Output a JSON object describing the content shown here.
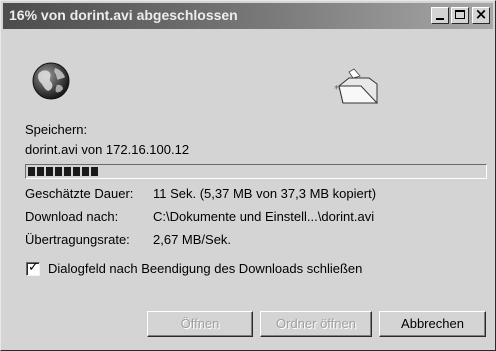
{
  "window": {
    "title": "16% von dorint.avi abgeschlossen"
  },
  "icons": {
    "globe": "globe-icon",
    "folder": "folder-icon"
  },
  "transfer": {
    "saving_label": "Speichern:",
    "file_source": "dorint.avi von 172.16.100.12",
    "progress_percent": 16
  },
  "details": {
    "estimated_label": "Geschätzte Dauer:",
    "estimated_value": "11 Sek. (5,37 MB von 37,3 MB kopiert)",
    "download_to_label": "Download nach:",
    "download_to_value": "C:\\Dokumente und Einstell...\\dorint.avi",
    "rate_label": "Übertragungsrate:",
    "rate_value": "2,67 MB/Sek."
  },
  "checkbox": {
    "label": "Dialogfeld nach Beendigung des Downloads schließen",
    "checked": true
  },
  "buttons": {
    "open": "Öffnen",
    "open_folder": "Ordner öffnen",
    "cancel": "Abbrechen"
  }
}
